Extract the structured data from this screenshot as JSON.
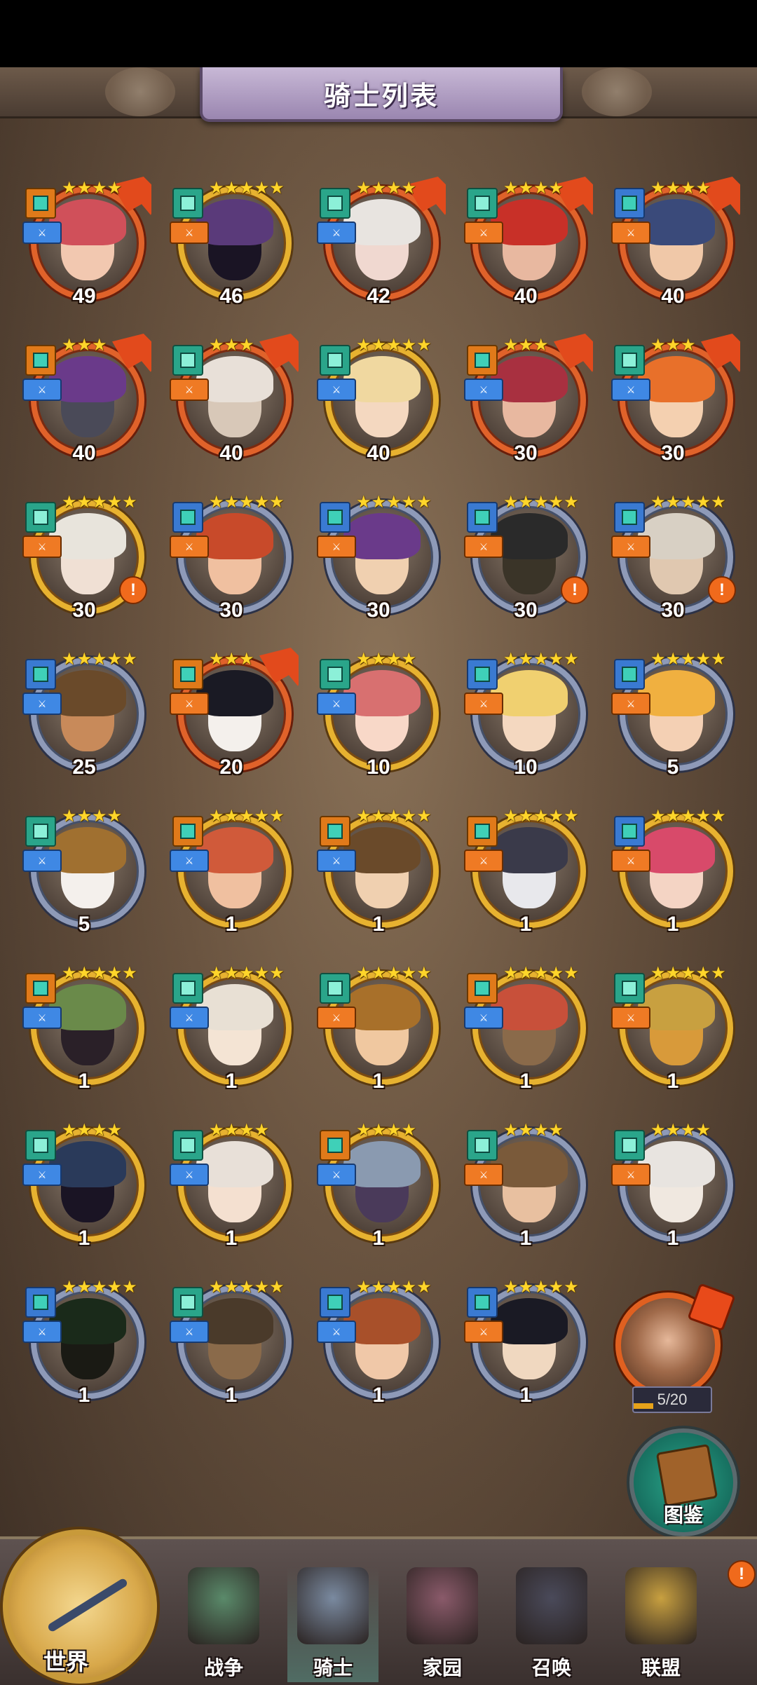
{
  "header": {
    "title": "骑士列表"
  },
  "knights": [
    {
      "level": "49",
      "stars": 4,
      "frame": "orange",
      "role": "orange",
      "sub": "blue",
      "hair": "#d0505a",
      "skin": "#f2c8b0"
    },
    {
      "level": "46",
      "stars": 5,
      "frame": "gold",
      "role": "teal",
      "sub": "orange",
      "hair": "#5a3a7a",
      "skin": "#1a1424"
    },
    {
      "level": "42",
      "stars": 4,
      "frame": "orange",
      "role": "teal",
      "sub": "blue",
      "hair": "#e8e4e0",
      "skin": "#f0d8d0"
    },
    {
      "level": "40",
      "stars": 4,
      "frame": "orange",
      "role": "teal",
      "sub": "orange",
      "hair": "#c83028",
      "skin": "#e8b8a0"
    },
    {
      "level": "40",
      "stars": 4,
      "frame": "orange",
      "role": "blue",
      "sub": "orange",
      "hair": "#3a4a7a",
      "skin": "#f0c8a8"
    },
    {
      "level": "40",
      "stars": 3,
      "frame": "orange",
      "role": "orange",
      "sub": "blue",
      "hair": "#6a3a8a",
      "skin": "#4a4a58"
    },
    {
      "level": "40",
      "stars": 3,
      "frame": "orange",
      "role": "teal",
      "sub": "orange",
      "hair": "#e8e0d8",
      "skin": "#d8c8b8"
    },
    {
      "level": "40",
      "stars": 5,
      "frame": "gold",
      "role": "teal",
      "sub": "blue",
      "hair": "#f0d8a0",
      "skin": "#f4d8c0"
    },
    {
      "level": "30",
      "stars": 3,
      "frame": "orange",
      "role": "orange",
      "sub": "blue",
      "hair": "#a83040",
      "skin": "#e8b8a0"
    },
    {
      "level": "30",
      "stars": 3,
      "frame": "orange",
      "role": "teal",
      "sub": "blue",
      "hair": "#e8702a",
      "skin": "#f4d0b0"
    },
    {
      "level": "30",
      "stars": 5,
      "frame": "gold",
      "role": "teal",
      "sub": "orange",
      "hair": "#e8e4dc",
      "skin": "#f0e0d4",
      "alert": true
    },
    {
      "level": "30",
      "stars": 5,
      "frame": "silver",
      "role": "blue",
      "sub": "orange",
      "hair": "#c84a2a",
      "skin": "#f0c0a0"
    },
    {
      "level": "30",
      "stars": 5,
      "frame": "silver",
      "role": "blue",
      "sub": "orange",
      "hair": "#6a3a8a",
      "skin": "#f0d0b0"
    },
    {
      "level": "30",
      "stars": 5,
      "frame": "silver",
      "role": "blue",
      "sub": "orange",
      "hair": "#2a2a2a",
      "skin": "#3a3428",
      "alert": true
    },
    {
      "level": "30",
      "stars": 5,
      "frame": "silver",
      "role": "blue",
      "sub": "orange",
      "hair": "#d8d0c4",
      "skin": "#e0c8b0",
      "alert": true
    },
    {
      "level": "25",
      "stars": 5,
      "frame": "silver",
      "role": "blue",
      "sub": "blue",
      "hair": "#6a4a2a",
      "skin": "#c88a5a"
    },
    {
      "level": "20",
      "stars": 3,
      "frame": "orange",
      "role": "orange",
      "sub": "orange",
      "hair": "#1a1a24",
      "skin": "#f4f0ec"
    },
    {
      "level": "10",
      "stars": 4,
      "frame": "gold",
      "role": "teal",
      "sub": "blue",
      "hair": "#d87070",
      "skin": "#f8d8c8"
    },
    {
      "level": "10",
      "stars": 5,
      "frame": "silver",
      "role": "blue",
      "sub": "orange",
      "hair": "#f0d070",
      "skin": "#f4d8c0"
    },
    {
      "level": "5",
      "stars": 5,
      "frame": "silver",
      "role": "blue",
      "sub": "orange",
      "hair": "#f0b040",
      "skin": "#f4d0b4"
    },
    {
      "level": "5",
      "stars": 4,
      "frame": "silver",
      "role": "teal",
      "sub": "blue",
      "hair": "#a07030",
      "skin": "#f4f0ec"
    },
    {
      "level": "1",
      "stars": 5,
      "frame": "gold",
      "role": "orange",
      "sub": "blue",
      "hair": "#d05a3a",
      "skin": "#f0c0a0"
    },
    {
      "level": "1",
      "stars": 5,
      "frame": "gold",
      "role": "orange",
      "sub": "blue",
      "hair": "#6a4a2a",
      "skin": "#f0d0b0"
    },
    {
      "level": "1",
      "stars": 5,
      "frame": "gold",
      "role": "orange",
      "sub": "orange",
      "hair": "#3a3a4a",
      "skin": "#e8e8ec"
    },
    {
      "level": "1",
      "stars": 5,
      "frame": "gold",
      "role": "blue",
      "sub": "orange",
      "hair": "#d84a6a",
      "skin": "#f4d4c4"
    },
    {
      "level": "1",
      "stars": 5,
      "frame": "gold",
      "role": "orange",
      "sub": "blue",
      "hair": "#6a8a4a",
      "skin": "#2a2028"
    },
    {
      "level": "1",
      "stars": 5,
      "frame": "gold",
      "role": "teal",
      "sub": "blue",
      "hair": "#e8e0d4",
      "skin": "#f4e4d4"
    },
    {
      "level": "1",
      "stars": 5,
      "frame": "gold",
      "role": "teal",
      "sub": "orange",
      "hair": "#a8702a",
      "skin": "#f0c8a0"
    },
    {
      "level": "1",
      "stars": 5,
      "frame": "gold",
      "role": "orange",
      "sub": "blue",
      "hair": "#c8503a",
      "skin": "#8a6a4a"
    },
    {
      "level": "1",
      "stars": 5,
      "frame": "gold",
      "role": "teal",
      "sub": "orange",
      "hair": "#c8a040",
      "skin": "#d89a3a"
    },
    {
      "level": "1",
      "stars": 4,
      "frame": "gold",
      "role": "teal",
      "sub": "blue",
      "hair": "#2a3a5a",
      "skin": "#1a1424"
    },
    {
      "level": "1",
      "stars": 4,
      "frame": "gold",
      "role": "teal",
      "sub": "blue",
      "hair": "#e8e0d8",
      "skin": "#f4e0d0"
    },
    {
      "level": "1",
      "stars": 4,
      "frame": "gold",
      "role": "orange",
      "sub": "blue",
      "hair": "#8a9ab0",
      "skin": "#4a3a5a"
    },
    {
      "level": "1",
      "stars": 4,
      "frame": "silver",
      "role": "teal",
      "sub": "orange",
      "hair": "#7a5a3a",
      "skin": "#e8c0a0"
    },
    {
      "level": "1",
      "stars": 4,
      "frame": "silver",
      "role": "teal",
      "sub": "orange",
      "hair": "#e8e4e0",
      "skin": "#f0e8e0"
    },
    {
      "level": "1",
      "stars": 5,
      "frame": "silver",
      "role": "blue",
      "sub": "blue",
      "hair": "#1a2a1a",
      "skin": "#1a1a14"
    },
    {
      "level": "1",
      "stars": 5,
      "frame": "silver",
      "role": "teal",
      "sub": "blue",
      "hair": "#4a3a2a",
      "skin": "#8a6a4a"
    },
    {
      "level": "1",
      "stars": 5,
      "frame": "silver",
      "role": "blue",
      "sub": "blue",
      "hair": "#a8502a",
      "skin": "#f0c8a8"
    },
    {
      "level": "1",
      "stars": 5,
      "frame": "silver",
      "role": "blue",
      "sub": "orange",
      "hair": "#1a1a24",
      "skin": "#f0d8c0"
    }
  ],
  "fragment": {
    "progress_text": "5/20",
    "progress_fraction": 0.25
  },
  "catalog": {
    "label": "图鉴"
  },
  "nav": {
    "world": "世界",
    "items": [
      {
        "label": "战争",
        "color": "#5a8a6a"
      },
      {
        "label": "骑士",
        "color": "#7a8aa0"
      },
      {
        "label": "家园",
        "color": "#8a5a6a"
      },
      {
        "label": "召唤",
        "color": "#4a4a5a"
      },
      {
        "label": "联盟",
        "color": "#c8a040"
      }
    ],
    "alert": "!"
  },
  "colors": {
    "star": "#ffd52a",
    "alert": "#f06a1c",
    "banner": "#b8a6cc"
  }
}
